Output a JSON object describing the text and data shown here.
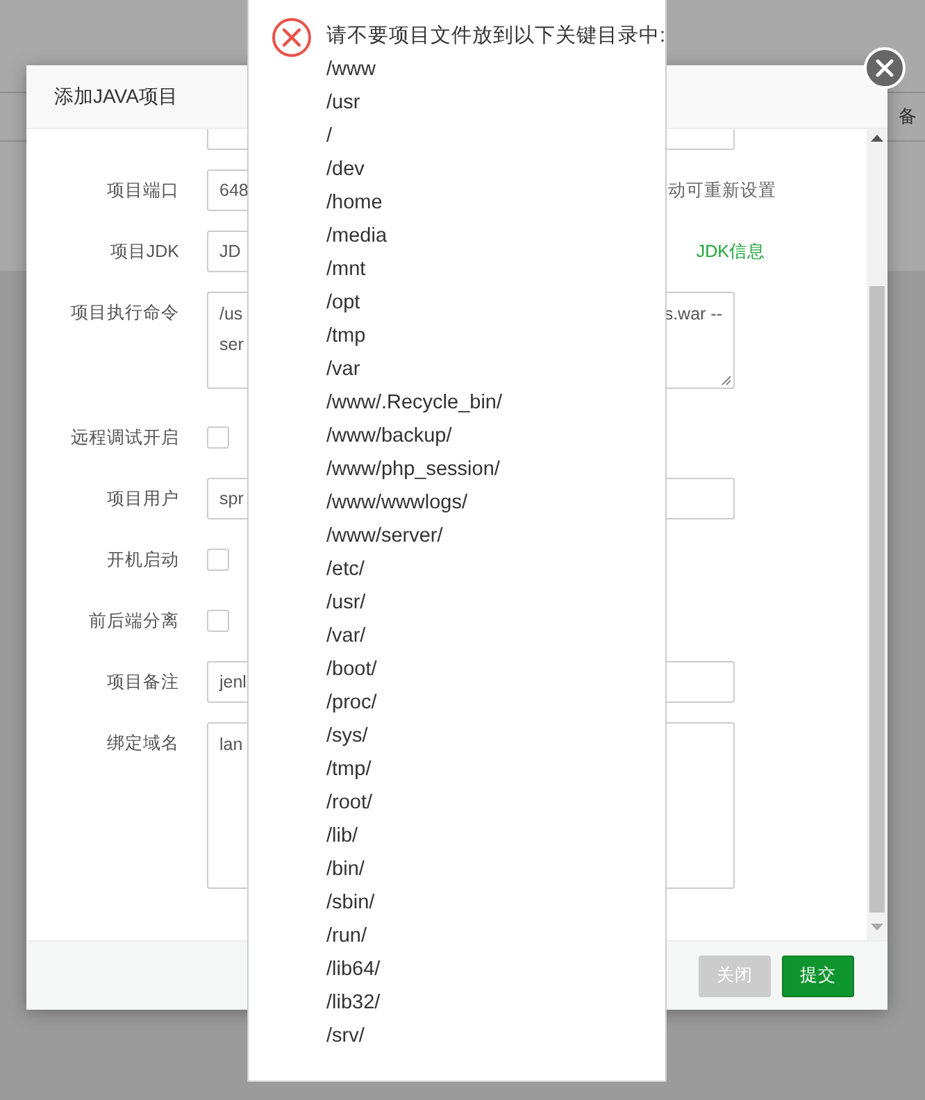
{
  "background": {
    "column_header": "备"
  },
  "dialog": {
    "title": "添加JAVA项目",
    "fields": [
      {
        "kind": "input"
      },
      {
        "kind": "input",
        "label": "项目端口",
        "value": "648",
        "hint": "动可重新设置"
      },
      {
        "kind": "select",
        "label": "项目JDK",
        "value": "JD",
        "link": "JDK信息"
      },
      {
        "kind": "textarea",
        "label": "项目执行命令",
        "lines": [
          "/us",
          "ser"
        ],
        "line_end": "s.war --"
      },
      {
        "kind": "checkbox",
        "label": "远程调试开启",
        "checked": false
      },
      {
        "kind": "input",
        "label": "项目用户",
        "value": "spr"
      },
      {
        "kind": "checkbox",
        "label": "开机启动",
        "checked": false
      },
      {
        "kind": "checkbox",
        "label": "前后端分离",
        "checked": false
      },
      {
        "kind": "input",
        "label": "项目备注",
        "value": "jenl"
      },
      {
        "kind": "textarea",
        "label": "绑定域名",
        "lines": [
          "lan"
        ]
      }
    ],
    "buttons": [
      {
        "label": "关闭",
        "disabled": true
      },
      {
        "label": "提交",
        "disabled": false
      }
    ]
  },
  "alert": {
    "message": "请不要项目文件放到以下关键目录中:",
    "paths": [
      "/www",
      "/usr",
      "/",
      "/dev",
      "/home",
      "/media",
      "/mnt",
      "/opt",
      "/tmp",
      "/var",
      "/www/.Recycle_bin/",
      "/www/backup/",
      "/www/php_session/",
      "/www/wwwlogs/",
      "/www/server/",
      "/etc/",
      "/usr/",
      "/var/",
      "/boot/",
      "/proc/",
      "/sys/",
      "/tmp/",
      "/root/",
      "/lib/",
      "/bin/",
      "/sbin/",
      "/run/",
      "/lib64/",
      "/lib32/",
      "/srv/"
    ]
  }
}
